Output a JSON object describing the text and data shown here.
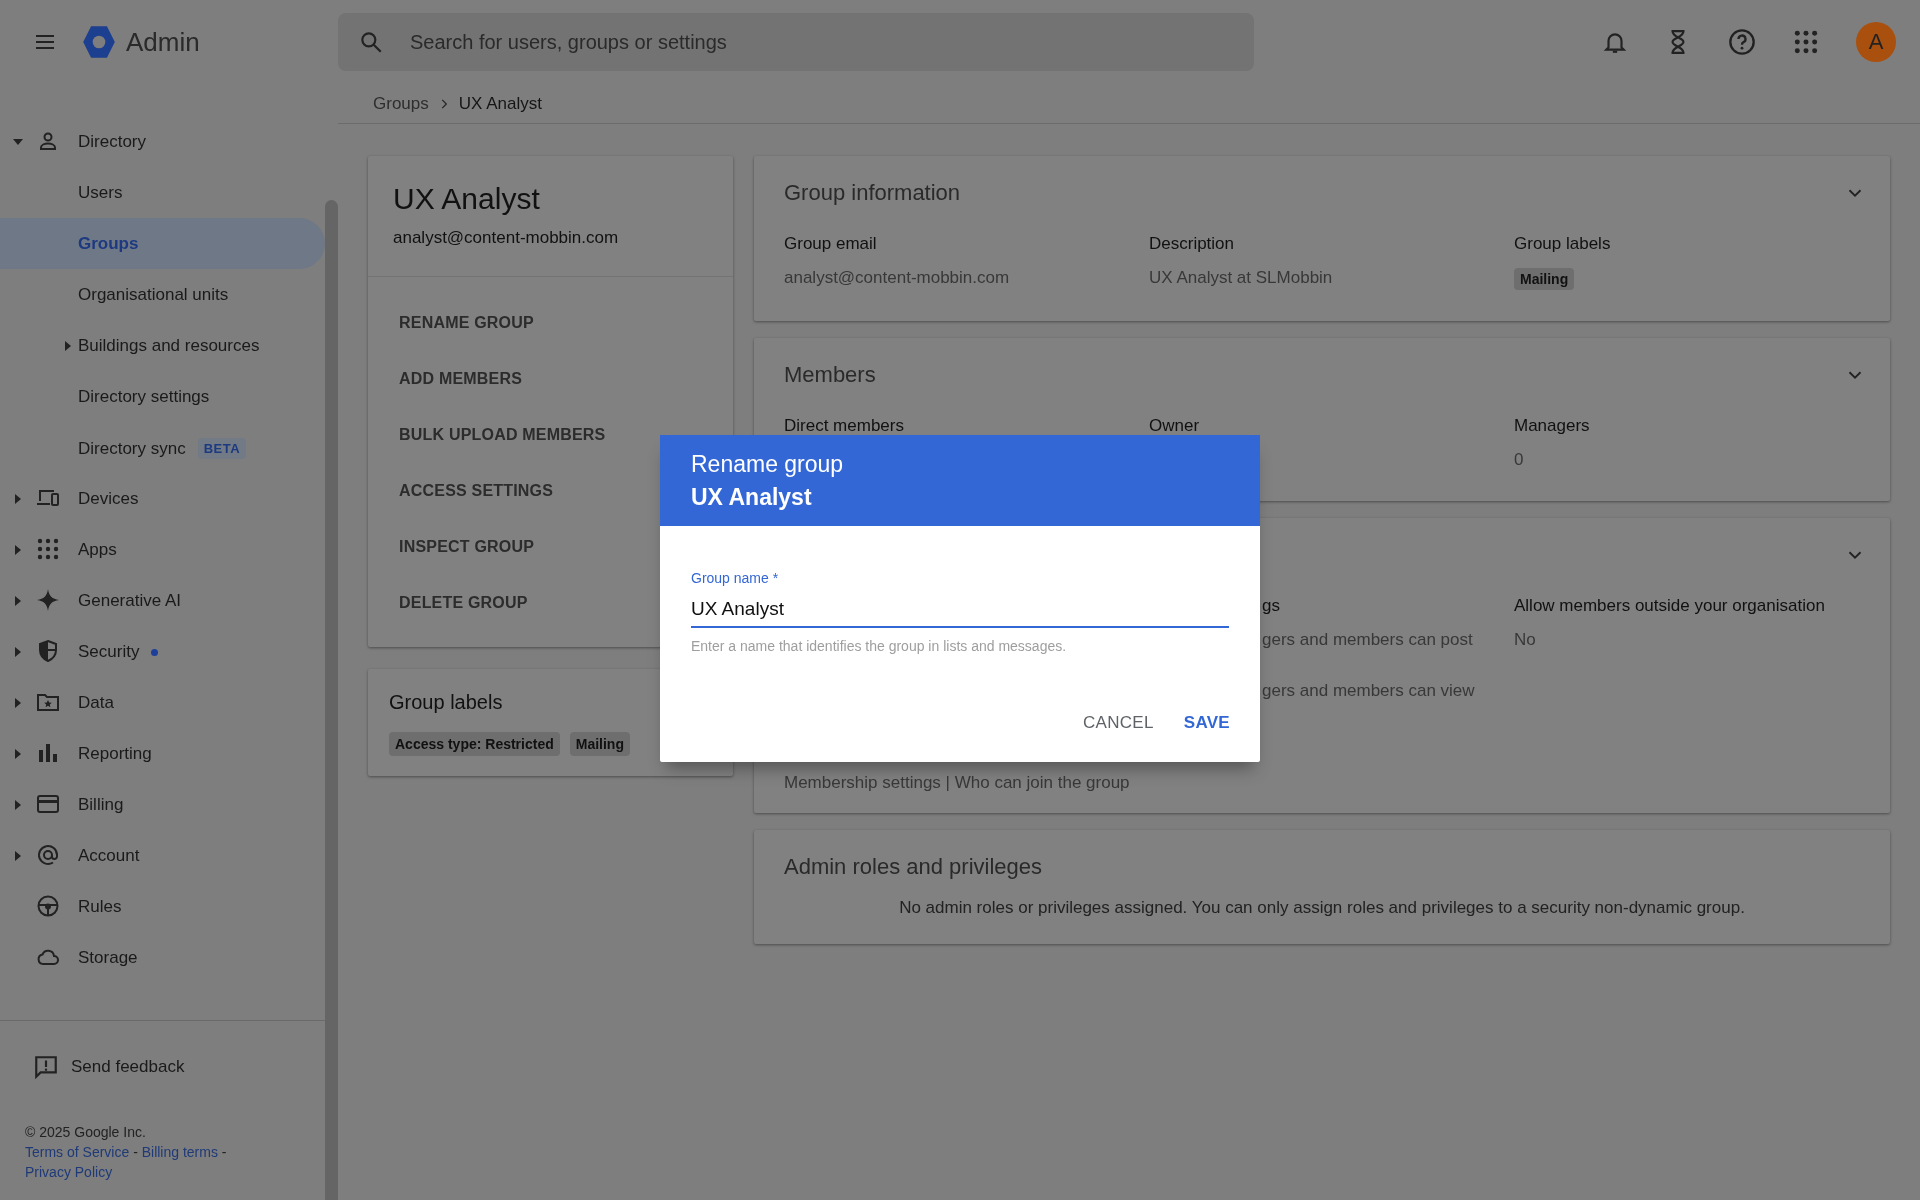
{
  "topbar": {
    "app_name": "Admin",
    "search": {
      "placeholder": "Search for users, groups or settings"
    },
    "avatar_letter": "A"
  },
  "breadcrumb": [
    "Groups",
    "UX Analyst"
  ],
  "sidebar": {
    "items": [
      {
        "label": "Directory",
        "expanded": true,
        "selected": false,
        "children": [
          {
            "label": "Users",
            "selected": false
          },
          {
            "label": "Groups",
            "selected": true
          },
          {
            "label": "Organisational units",
            "selected": false
          },
          {
            "label": "Buildings and resources",
            "expanded": false,
            "selected": false
          },
          {
            "label": "Directory settings",
            "selected": false
          },
          {
            "label": "Directory sync",
            "badge": "BETA",
            "selected": false
          }
        ]
      },
      {
        "label": "Devices",
        "expanded": false,
        "selected": false
      },
      {
        "label": "Apps",
        "expanded": false,
        "selected": false
      },
      {
        "label": "Generative AI",
        "expanded": false,
        "selected": false
      },
      {
        "label": "Security",
        "expanded": false,
        "selected": false,
        "notification": true
      },
      {
        "label": "Data",
        "expanded": false,
        "selected": false
      },
      {
        "label": "Reporting",
        "expanded": false,
        "selected": false
      },
      {
        "label": "Billing",
        "expanded": false,
        "selected": false
      },
      {
        "label": "Account",
        "expanded": false,
        "selected": false
      },
      {
        "label": "Rules",
        "selected": false
      },
      {
        "label": "Storage",
        "selected": false
      }
    ],
    "feedback": "Send feedback",
    "copyright": "© 2025 Google Inc.",
    "legal": [
      {
        "kind": "link",
        "text": "Terms of Service"
      },
      {
        "kind": "separator",
        "text": "-"
      },
      {
        "kind": "link",
        "text": "Billing terms"
      },
      {
        "kind": "separator",
        "text": "-"
      },
      {
        "kind": "link",
        "text": "Privacy Policy"
      }
    ]
  },
  "group": {
    "name": "UX Analyst",
    "email": "analyst@content-mobbin.com",
    "actions": [
      "RENAME GROUP",
      "ADD MEMBERS",
      "BULK UPLOAD MEMBERS",
      "ACCESS SETTINGS",
      "INSPECT GROUP",
      "DELETE GROUP"
    ],
    "labels_card": {
      "title": "Group labels",
      "labels": [
        "Access type: Restricted",
        "Mailing"
      ]
    }
  },
  "cards": [
    {
      "title": "Group information",
      "collapsible": true,
      "columns": [
        {
          "items": [
            {
              "kind": "label",
              "text": "Group email"
            },
            {
              "kind": "value",
              "text": "analyst@content-mobbin.com"
            }
          ]
        },
        {
          "items": [
            {
              "kind": "label",
              "text": "Description"
            },
            {
              "kind": "value",
              "text": "UX Analyst at SLMobbin"
            }
          ]
        },
        {
          "items": [
            {
              "kind": "label",
              "text": "Group labels"
            },
            {
              "kind": "chip",
              "text": "Mailing"
            }
          ]
        }
      ]
    },
    {
      "title": "Members",
      "collapsible": true,
      "columns": [
        {
          "items": [
            {
              "kind": "label",
              "text": "Direct members"
            }
          ]
        },
        {
          "items": [
            {
              "kind": "label",
              "text": "Owner"
            }
          ]
        },
        {
          "items": [
            {
              "kind": "label",
              "text": "Managers"
            },
            {
              "kind": "value",
              "text": "0"
            }
          ]
        }
      ]
    },
    {
      "collapsible": true,
      "columns": [
        {
          "cut": true,
          "items": [
            {
              "kind": "label",
              "text": "gs"
            },
            {
              "kind": "value",
              "text": "gers and members can post"
            },
            {
              "kind": "value",
              "text": "gers and members can view"
            }
          ]
        },
        {
          "items": [
            {
              "kind": "label",
              "text": "Allow members outside your organisation"
            },
            {
              "kind": "value",
              "text": "No"
            }
          ]
        }
      ],
      "footer": "Membership settings | Who can join the group"
    },
    {
      "title": "Admin roles and privileges",
      "collapsible": false,
      "message": "No admin roles or privileges assigned. You can only assign roles and privileges to a security non-dynamic group."
    }
  ],
  "dialog": {
    "title": "Rename group",
    "subtitle": "UX Analyst",
    "field": {
      "label": "Group name *",
      "value": "UX Analyst",
      "hint": "Enter a name that identifies the group in lists and messages."
    },
    "buttons": [
      {
        "label": "CANCEL",
        "primary": false
      },
      {
        "label": "SAVE",
        "primary": true
      }
    ]
  }
}
